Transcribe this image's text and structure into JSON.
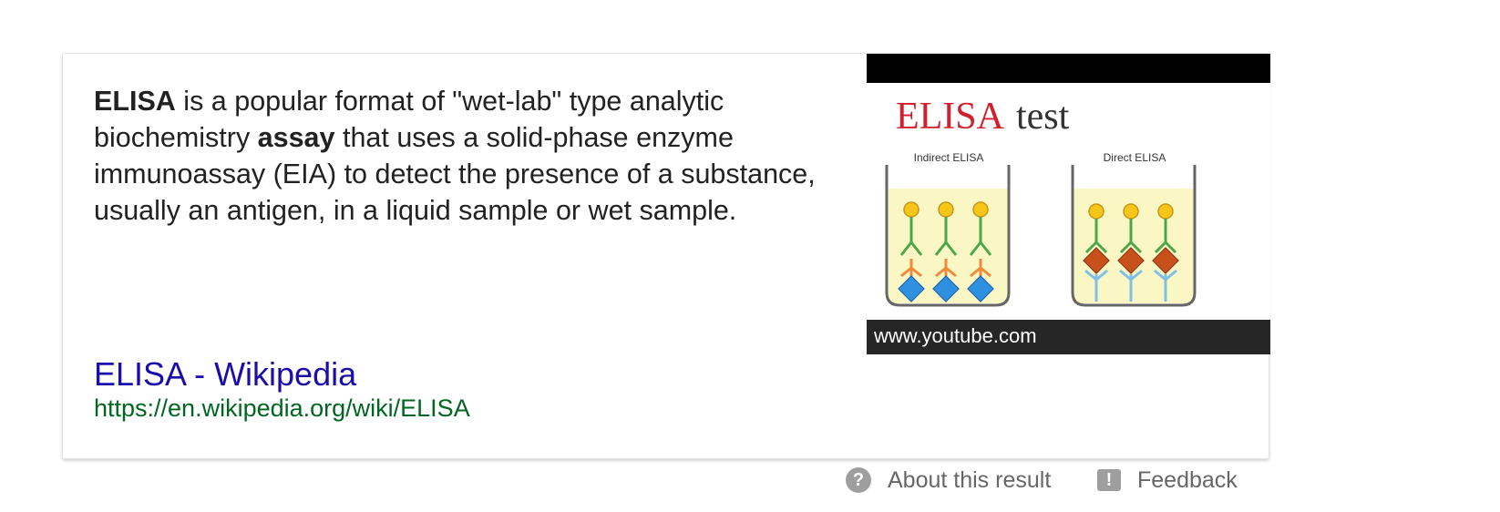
{
  "snippet": {
    "term": "ELISA",
    "text_1": " is a popular format of \"wet-lab\" type analytic biochemistry ",
    "bold_2": "assay",
    "text_2": " that uses a solid-phase enzyme immunoassay (EIA) to detect the presence of a substance, usually an antigen, in a liquid sample or wet sample."
  },
  "result": {
    "title": "ELISA - Wikipedia",
    "url": "https://en.wikipedia.org/wiki/ELISA"
  },
  "thumbnail": {
    "heading_red": "ELISA",
    "heading_dark": "test",
    "label_left": "Indirect ELISA",
    "label_right": "Direct ELISA",
    "caption": "www.youtube.com"
  },
  "footer": {
    "about_label": "About this result",
    "feedback_label": "Feedback",
    "about_icon": "question-icon",
    "feedback_icon": "exclamation-icon"
  },
  "colors": {
    "link": "#1a0dab",
    "url": "#006621",
    "heading_red": "#d21f2c"
  }
}
